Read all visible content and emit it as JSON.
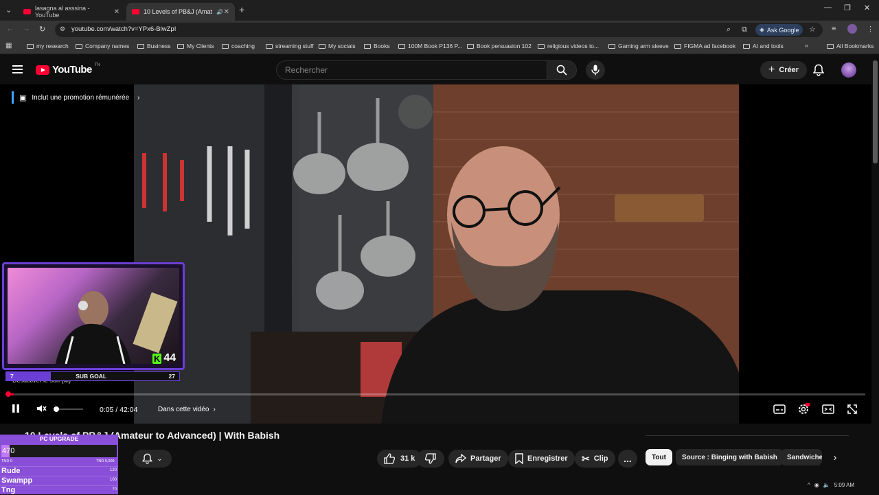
{
  "browser": {
    "tabs": [
      {
        "label": "lasagna al asssina - YouTube",
        "active": false
      },
      {
        "label": "10 Levels of PB&J (Amateur",
        "active": true
      }
    ],
    "new_tab": "+",
    "url": "youtube.com/watch?v=YPx6-BlwZpI",
    "ask_google": "Ask Google",
    "bookmarks": [
      "my research",
      "Company names",
      "Business",
      "My Clients",
      "coaching",
      "streaming stuff",
      "My socials",
      "Books",
      "100M Book P136 P...",
      "Book persuasion 102",
      "religious videos to...",
      "Gaming arm sleeve",
      "FIGMA ad facebook",
      "AI and tools"
    ],
    "all_bookmarks": "All Bookmarks"
  },
  "youtube": {
    "logo": "YouTube",
    "logo_suffix": "TN",
    "search_placeholder": "Rechercher",
    "create_label": "Créer"
  },
  "player": {
    "promo": "Inclut une promotion rémunérée",
    "mute_tooltip": "Désactiver le son (M)",
    "time": "0:05 / 42:04",
    "chapters": "Dans cette vidéo",
    "progress_fraction": 0.002,
    "volume_fraction": 0.0
  },
  "stream_overlay": {
    "score": "44",
    "sub_goal": {
      "label": "SUB GOAL",
      "current": "7",
      "target": "27"
    }
  },
  "video_meta": {
    "title": "10 Levels of PB&J (Amateur to Advanced) | With Babish",
    "likes": "31 k",
    "share": "Partager",
    "save": "Enregistrer",
    "clip": "Clip",
    "more": "..."
  },
  "chips": [
    "Tout",
    "Source : Binging with Babish",
    "Sandwiches"
  ],
  "pc_upgrade": {
    "title": "PC UPGRADE",
    "value": "470",
    "min": "TND 0",
    "max": "TND 5,000",
    "leaderboard": [
      {
        "name": "Rude",
        "amount": "120"
      },
      {
        "name": "Swampp",
        "amount": "100"
      },
      {
        "name": "Tng",
        "amount": "70"
      }
    ]
  },
  "system": {
    "clock": "5:09 AM"
  }
}
